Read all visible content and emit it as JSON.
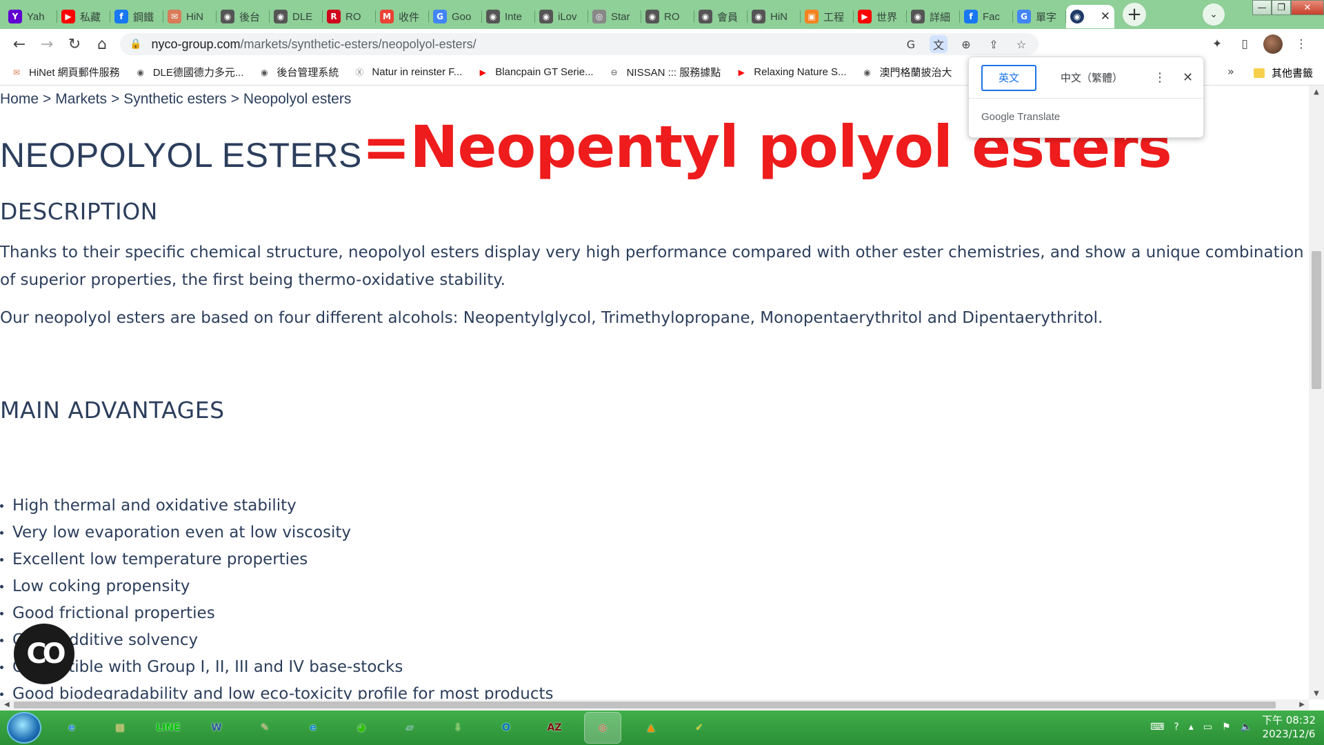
{
  "browser": {
    "tabs": [
      {
        "favicon": "Y",
        "color": "#6001d2",
        "title": "Yah"
      },
      {
        "favicon": "▶",
        "color": "#ff0000",
        "title": "私藏"
      },
      {
        "favicon": "f",
        "color": "#1877f2",
        "title": "鋼鐵"
      },
      {
        "favicon": "✉",
        "color": "#d87c5a",
        "title": "HiN"
      },
      {
        "favicon": "◉",
        "color": "#555555",
        "title": "後台"
      },
      {
        "favicon": "◉",
        "color": "#555555",
        "title": "DLE"
      },
      {
        "favicon": "R",
        "color": "#d0021b",
        "title": "RO"
      },
      {
        "favicon": "M",
        "color": "#ea4335",
        "title": "收件"
      },
      {
        "favicon": "G",
        "color": "#4285f4",
        "title": "Goo"
      },
      {
        "favicon": "◉",
        "color": "#555555",
        "title": "Inte"
      },
      {
        "favicon": "◉",
        "color": "#555555",
        "title": "iLov"
      },
      {
        "favicon": "◎",
        "color": "#888888",
        "title": "Star"
      },
      {
        "favicon": "◉",
        "color": "#555555",
        "title": "RO"
      },
      {
        "favicon": "◉",
        "color": "#555555",
        "title": "會員"
      },
      {
        "favicon": "◉",
        "color": "#555555",
        "title": "HiN"
      },
      {
        "favicon": "▣",
        "color": "#f58220",
        "title": "工程"
      },
      {
        "favicon": "▶",
        "color": "#ff0000",
        "title": "世界"
      },
      {
        "favicon": "◉",
        "color": "#555555",
        "title": "詳細"
      },
      {
        "favicon": "f",
        "color": "#1877f2",
        "title": "Fac"
      },
      {
        "favicon": "G",
        "color": "#4285f4",
        "title": "單字"
      }
    ],
    "active_tab": {
      "favicon": "◉",
      "color": "#1f3a68",
      "title": "",
      "close": "✕"
    },
    "new_tab": "+",
    "tab_search": "⌄",
    "window": {
      "minimize": "—",
      "maximize": "❐",
      "close": "✕"
    },
    "toolbar": {
      "back": "←",
      "forward": "→",
      "reload": "↻",
      "home": "⌂",
      "lock": "🔒",
      "url_host": "nyco-group.com",
      "url_path": "/markets/synthetic-esters/neopolyol-esters/",
      "omni_icons": [
        "G",
        "文",
        "⊕",
        "⇪",
        "☆"
      ],
      "right_icons": [
        "✦",
        "▯",
        "⋮"
      ]
    },
    "bookmarks": [
      {
        "icon": "✉",
        "color": "#d87c5a",
        "label": "HiNet 網頁郵件服務"
      },
      {
        "icon": "◉",
        "color": "#555555",
        "label": "DLE德國德力多元..."
      },
      {
        "icon": "◉",
        "color": "#555555",
        "label": "後台管理系統"
      },
      {
        "icon": "Ⓧ",
        "color": "#777777",
        "label": "Natur in reinster F..."
      },
      {
        "icon": "▶",
        "color": "#ff0000",
        "label": "Blancpain GT Serie..."
      },
      {
        "icon": "⊖",
        "color": "#555555",
        "label": "NISSAN ::: 服務據點"
      },
      {
        "icon": "▶",
        "color": "#ff0000",
        "label": "Relaxing Nature S..."
      },
      {
        "icon": "◉",
        "color": "#555555",
        "label": "澳門格蘭披治大"
      }
    ],
    "bookmarks_more": "»",
    "other_bookmarks": "其他書籤"
  },
  "translate_popup": {
    "source_lang": "英文",
    "target_lang": "中文（繁體）",
    "menu": "⋮",
    "close": "✕",
    "brand_google": "Google",
    "brand_translate": "Translate"
  },
  "page": {
    "breadcrumb": [
      "Home",
      ">",
      "Markets",
      ">",
      "Synthetic esters",
      ">",
      "Neopolyol esters"
    ],
    "title": "NEOPOLYOL ESTERS",
    "annotation": "=Neopentyl polyol esters",
    "annotation_color": "#ee1c1c",
    "description_heading": "DESCRIPTION",
    "description_p1": "Thanks to their specific chemical structure, neopolyol esters display very high performance compared with other ester chemistries, and show a unique combination of superior properties, the first being thermo-oxidative stability.",
    "description_p2": "Our neopolyol esters are based on four different alcohols: Neopentylglycol, Trimethylopropane, Monopentaerythritol and Dipentaerythritol.",
    "advantages_heading": "MAIN ADVANTAGES",
    "advantages": [
      "High thermal and oxidative stability",
      "Very low evaporation even at low viscosity",
      "Excellent low temperature properties",
      "Low coking propensity",
      "Good frictional properties",
      "Good additive solvency",
      "Compatible with Group I, II, III and IV base-stocks",
      "Good biodegradability and low eco-toxicity profile for most products"
    ]
  },
  "taskbar": {
    "apps": [
      {
        "name": "ie",
        "glyph": "e",
        "color": "#2d8de0"
      },
      {
        "name": "explorer",
        "glyph": "▤",
        "color": "#e8b84a"
      },
      {
        "name": "line",
        "glyph": "LINE",
        "color": "#00c300"
      },
      {
        "name": "word",
        "glyph": "W",
        "color": "#2b579a"
      },
      {
        "name": "paint",
        "glyph": "✎",
        "color": "#c9a66b"
      },
      {
        "name": "edge",
        "glyph": "e",
        "color": "#0c8ad6"
      },
      {
        "name": "wechat",
        "glyph": "◕",
        "color": "#2dc100"
      },
      {
        "name": "notes",
        "glyph": "▱",
        "color": "#7fb2d8"
      },
      {
        "name": "download",
        "glyph": "⇩",
        "color": "#7dc242"
      },
      {
        "name": "outlook",
        "glyph": "O",
        "color": "#0072c6"
      },
      {
        "name": "game",
        "glyph": "AZ",
        "color": "#7a1010"
      },
      {
        "name": "chrome",
        "glyph": "◎",
        "color": "#db4437"
      },
      {
        "name": "vlc",
        "glyph": "▲",
        "color": "#f08a00"
      },
      {
        "name": "norton",
        "glyph": "✓",
        "color": "#ffd200"
      }
    ],
    "clock_time": "下午 08:32",
    "clock_date": "2023/12/6"
  },
  "reader_fab_glyph": "CO"
}
